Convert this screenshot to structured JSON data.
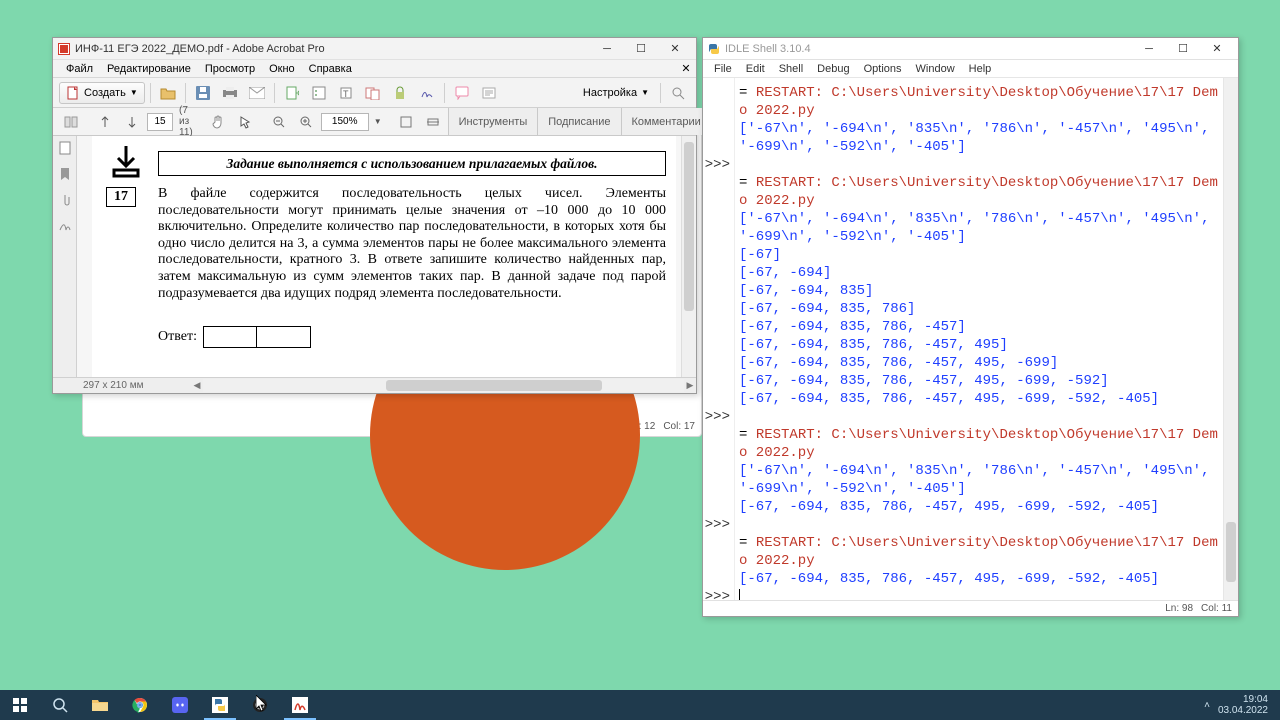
{
  "acrobat": {
    "title": "ИНФ-11 ЕГЭ 2022_ДЕМО.pdf - Adobe Acrobat Pro",
    "menu": {
      "file": "Файл",
      "edit": "Редактирование",
      "view": "Просмотр",
      "window": "Окно",
      "help": "Справка"
    },
    "create_label": "Создать",
    "settings_label": "Настройка",
    "page_current": "15",
    "page_total": "(7 из 11)",
    "zoom": "150%",
    "tabs": {
      "tools": "Инструменты",
      "sign": "Подписание",
      "comments": "Комментарии"
    },
    "task_header": "Задание выполняется с использованием прилагаемых файлов.",
    "task_number": "17",
    "task_text": "В файле содержится последовательность целых чисел. Элементы последовательности могут принимать целые значения от –10 000 до 10 000 включительно. Определите количество пар последовательности, в которых хотя бы одно число делится на 3, а сумма элементов пары не более максимального элемента последовательности, кратного 3. В ответе запишите количество найденных пар, затем максимальную из сумм элементов таких пар. В данной задаче под парой подразумевается два идущих подряд элемента последовательности.",
    "answer_label": "Ответ:",
    "status_dim": "297 x 210 мм"
  },
  "acrobat_back": {
    "status_ln": "Ln: 12",
    "status_col": "Col: 17"
  },
  "idle": {
    "title": "IDLE Shell 3.10.4",
    "menu": {
      "file": "File",
      "edit": "Edit",
      "shell": "Shell",
      "debug": "Debug",
      "options": "Options",
      "window": "Window",
      "help": "Help"
    },
    "status_ln": "Ln: 98",
    "status_col": "Col: 11",
    "lines": [
      {
        "prefix": "= ",
        "red": "RESTART: C:\\Users\\University\\Desktop\\Обучение\\17\\17 Demo 2022.py"
      },
      {
        "blue": "['-67\\n', '-694\\n', '835\\n', '786\\n', '-457\\n', '495\\n', '-699\\n', '-592\\n', '-405']"
      },
      {
        "prompt": ">>> "
      },
      {
        "prefix": "= ",
        "red": "RESTART: C:\\Users\\University\\Desktop\\Обучение\\17\\17 Demo 2022.py"
      },
      {
        "blue": "['-67\\n', '-694\\n', '835\\n', '786\\n', '-457\\n', '495\\n', '-699\\n', '-592\\n', '-405']"
      },
      {
        "blue": "[-67]"
      },
      {
        "blue": "[-67, -694]"
      },
      {
        "blue": "[-67, -694, 835]"
      },
      {
        "blue": "[-67, -694, 835, 786]"
      },
      {
        "blue": "[-67, -694, 835, 786, -457]"
      },
      {
        "blue": "[-67, -694, 835, 786, -457, 495]"
      },
      {
        "blue": "[-67, -694, 835, 786, -457, 495, -699]"
      },
      {
        "blue": "[-67, -694, 835, 786, -457, 495, -699, -592]"
      },
      {
        "blue": "[-67, -694, 835, 786, -457, 495, -699, -592, -405]"
      },
      {
        "prompt": ">>> "
      },
      {
        "prefix": "= ",
        "red": "RESTART: C:\\Users\\University\\Desktop\\Обучение\\17\\17 Demo 2022.py"
      },
      {
        "blue": "['-67\\n', '-694\\n', '835\\n', '786\\n', '-457\\n', '495\\n', '-699\\n', '-592\\n', '-405']"
      },
      {
        "blue": "[-67, -694, 835, 786, -457, 495, -699, -592, -405]"
      },
      {
        "prompt": ">>> "
      },
      {
        "prefix": "= ",
        "red": "RESTART: C:\\Users\\University\\Desktop\\Обучение\\17\\17 Demo 2022.py"
      },
      {
        "blue": "[-67, -694, 835, 786, -457, 495, -699, -592, -405]"
      },
      {
        "prompt": ">>> ",
        "caret": true
      }
    ]
  },
  "taskbar": {
    "time": "19:04",
    "date": "03.04.2022"
  }
}
